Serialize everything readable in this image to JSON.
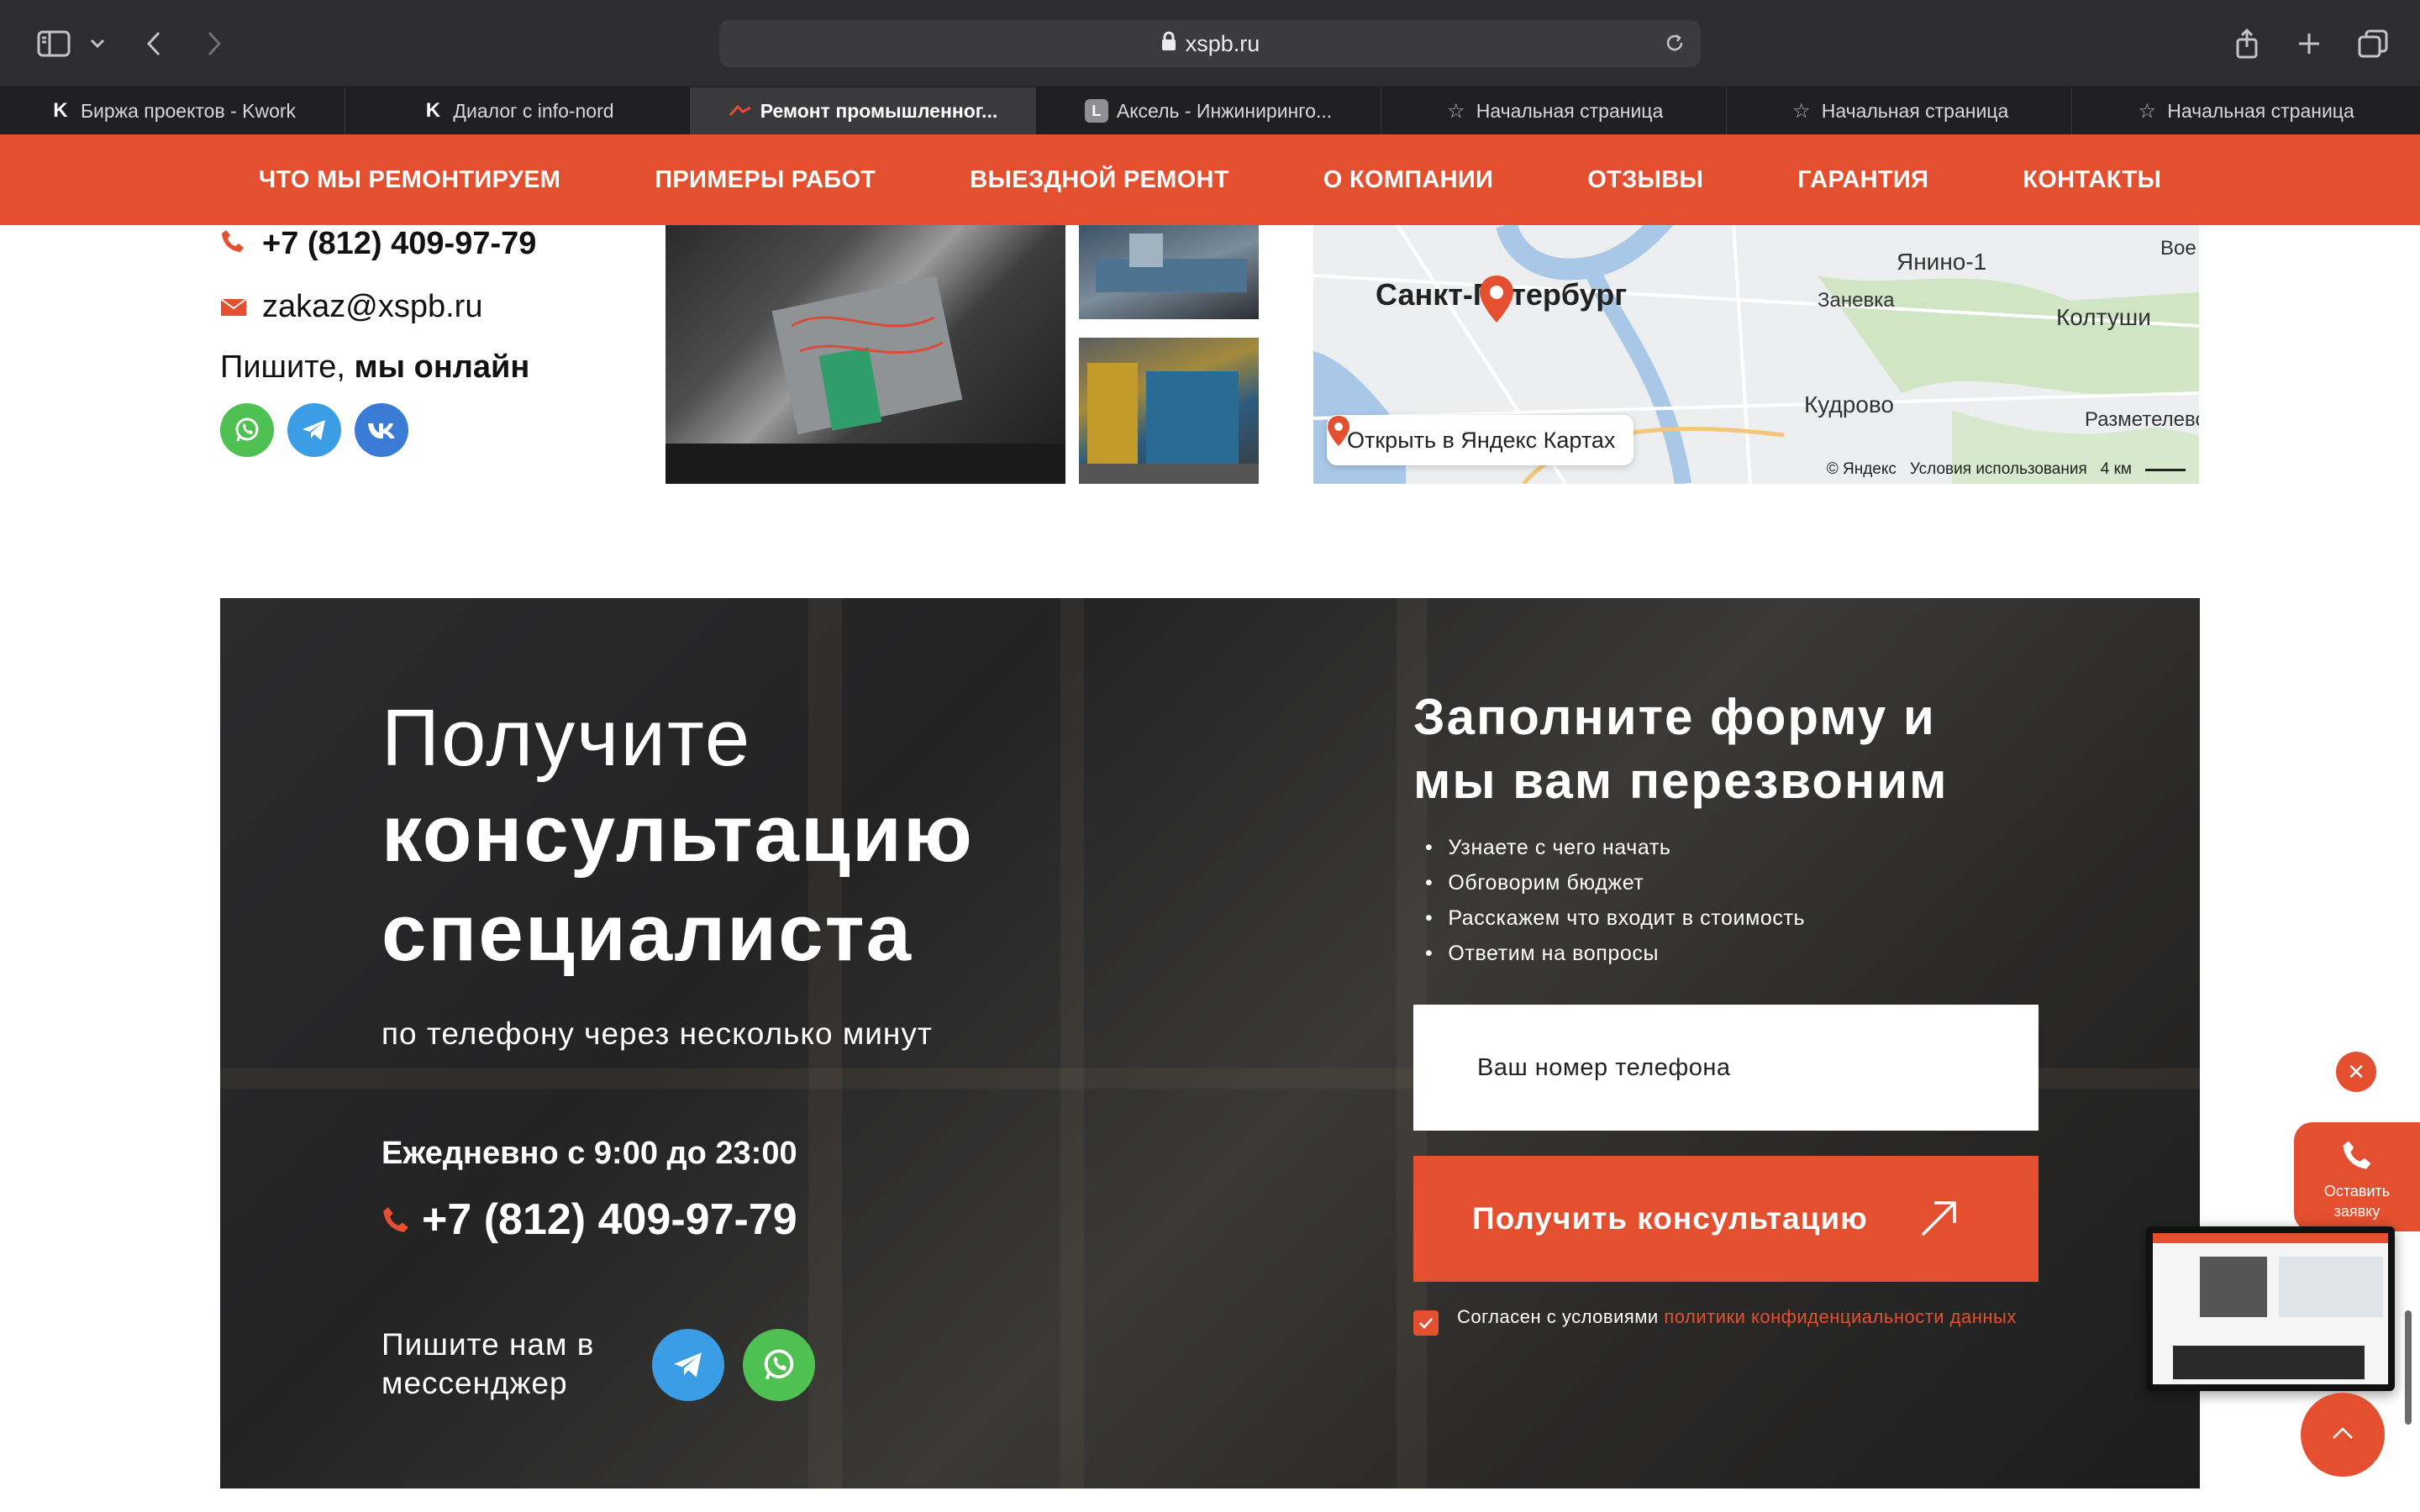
{
  "browser": {
    "url": "xspb.ru",
    "tabs": [
      {
        "label": "Биржа проектов - Kwork",
        "icon": "kwork-icon",
        "active": false
      },
      {
        "label": "Диалог с info-nord",
        "icon": "kwork-icon",
        "active": false
      },
      {
        "label": "Ремонт промышленног...",
        "icon": "site-favicon",
        "active": true
      },
      {
        "label": "Аксель - Инжиниринго...",
        "icon": "letter-l-icon",
        "active": false
      },
      {
        "label": "Начальная страница",
        "icon": "star-icon",
        "active": false
      },
      {
        "label": "Начальная страница",
        "icon": "star-icon",
        "active": false
      },
      {
        "label": "Начальная страница",
        "icon": "star-icon",
        "active": false
      }
    ],
    "tab_glyph_k": "K",
    "tab_glyph_l": "L"
  },
  "nav": {
    "items": [
      "Что мы ремонтируем",
      "Примеры работ",
      "Выездной ремонт",
      "О компании",
      "Отзывы",
      "Гарантия",
      "Контакты"
    ]
  },
  "contacts": {
    "phone": "+7 (812) 409-97-79",
    "email": "zakaz@xspb.ru",
    "online_prefix": "Пишите, ",
    "online_bold": "мы онлайн"
  },
  "map": {
    "city": "Санкт-Петербург",
    "labels": [
      "Янино-1",
      "Заневка",
      "Колтуши",
      "Кудрово",
      "Разметелево",
      "Вое"
    ],
    "open_button": "Открыть в Яндекс Картах",
    "footer_brand": "© Яндекс",
    "footer_terms": "Условия использования",
    "scale": "4 км"
  },
  "consult": {
    "title_line1": "Получите",
    "title_line2": "консультацию",
    "title_line3": "специалиста",
    "subtitle": "по телефону через несколько минут",
    "hours": "Ежедневно с 9:00 до 23:00",
    "phone": "+7 (812) 409-97-79",
    "write_line1": "Пишите нам в",
    "write_line2": "мессенджер"
  },
  "form": {
    "title_line1": "Заполните форму и",
    "title_line2": "мы вам перезвоним",
    "bullets": [
      "Узнаете с чего начать",
      "Обговорим бюджет",
      "Расскажем что входит в стоимость",
      "Ответим на вопросы"
    ],
    "phone_placeholder": "Ваш номер телефона",
    "submit_label": "Получить консультацию",
    "agree_text": "Согласен с условиями ",
    "agree_link": "политики конфиденциальности данных",
    "agree_checked": true
  },
  "widgets": {
    "leave_request_line1": "Оставить",
    "leave_request_line2": "заявку",
    "close_glyph": "✕"
  },
  "colors": {
    "accent": "#e4502f",
    "whatsapp": "#4ec152",
    "telegram": "#3b9de6",
    "vk": "#3a7bd5"
  }
}
